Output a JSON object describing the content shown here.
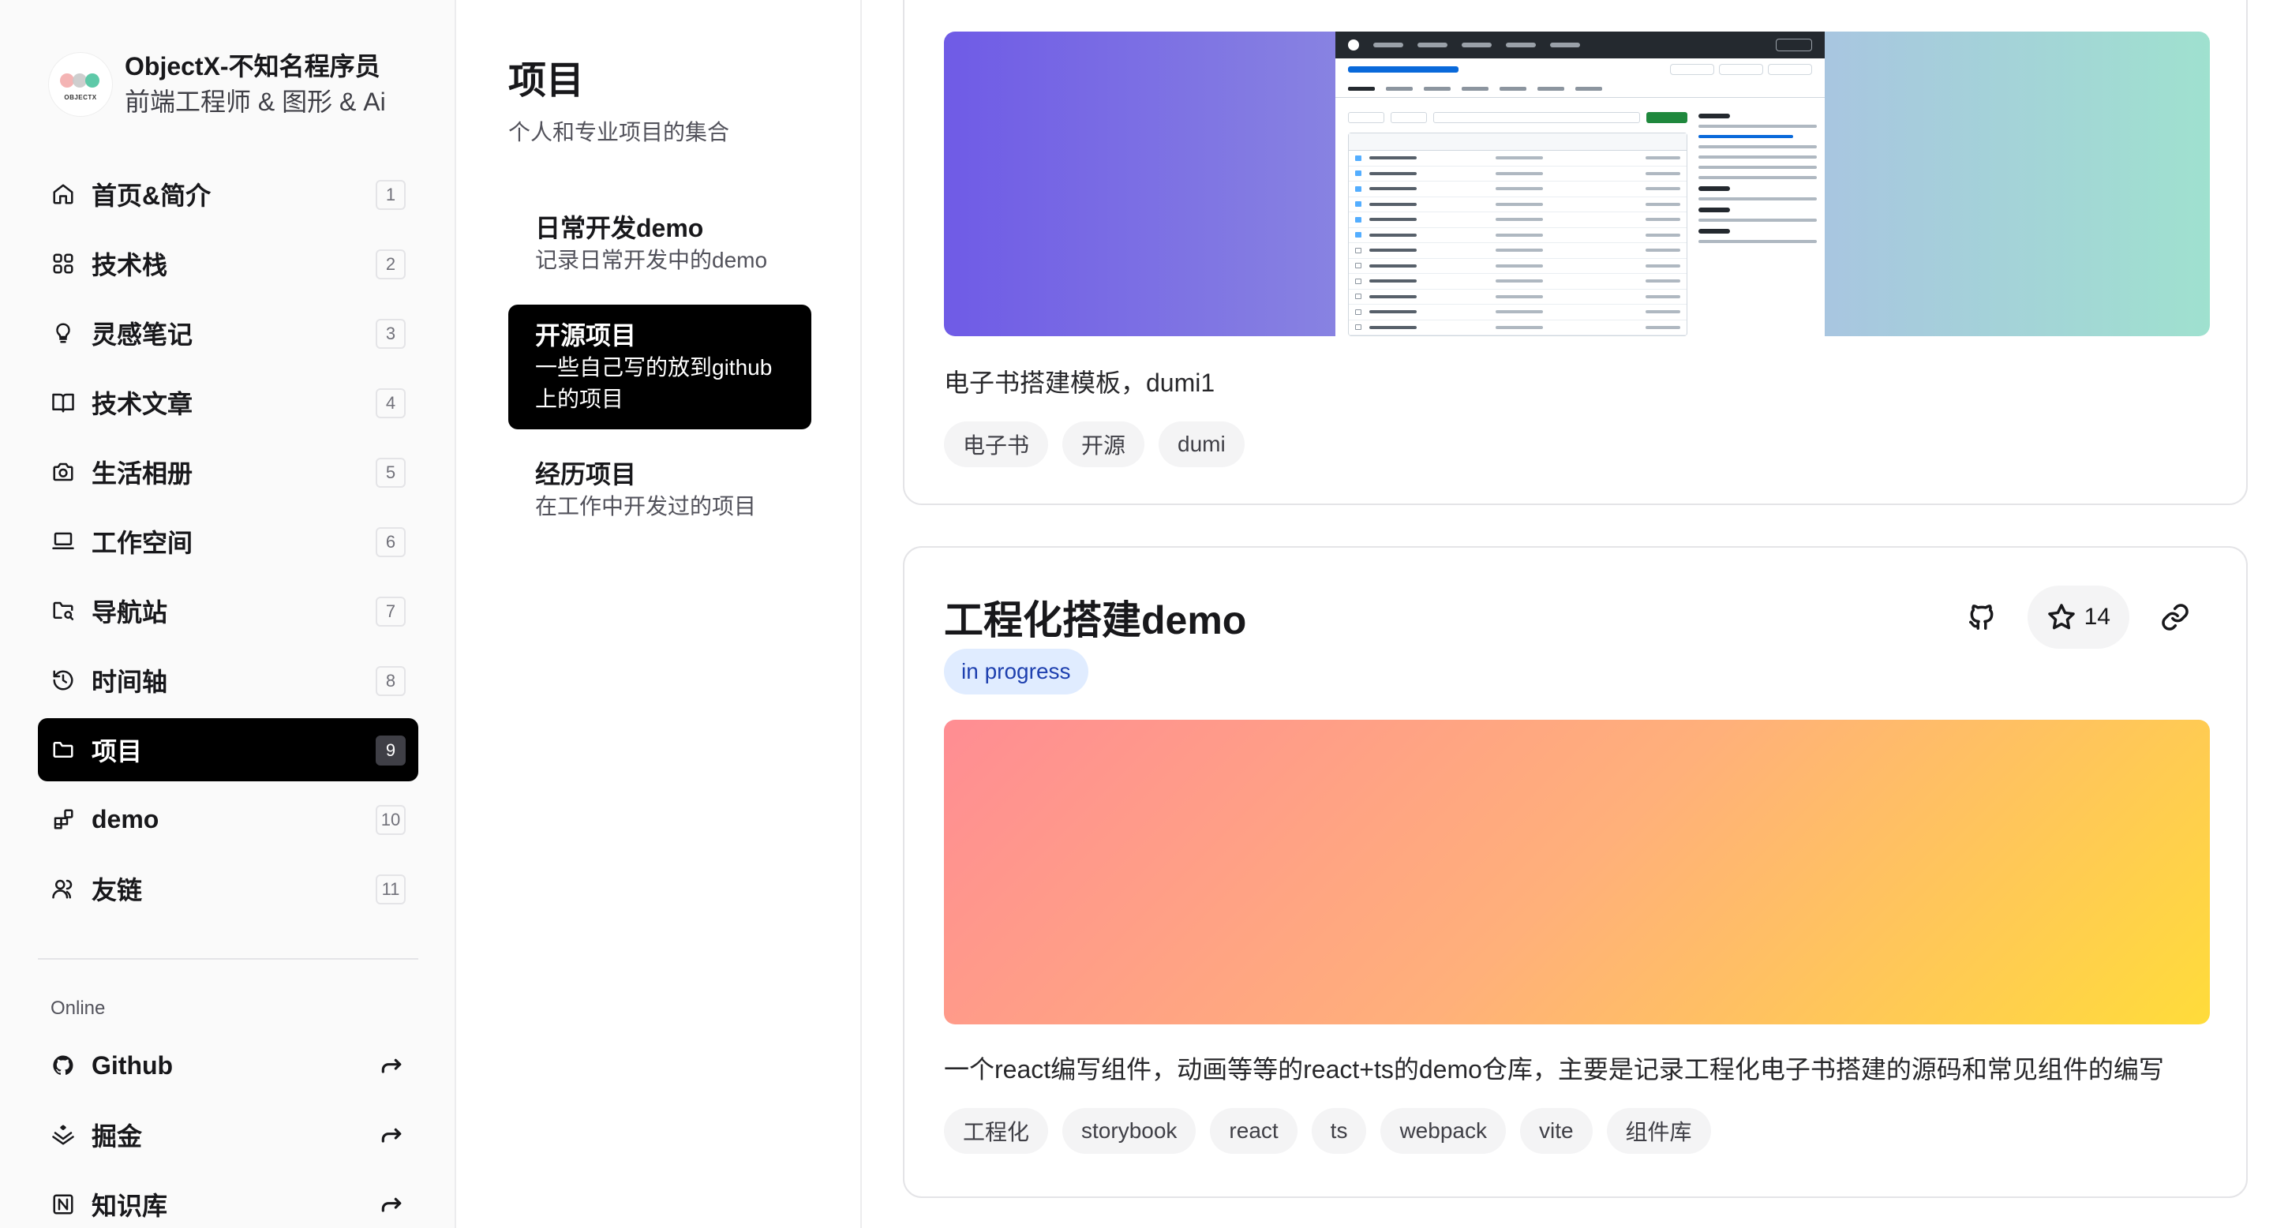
{
  "profile": {
    "name": "ObjectX-不知名程序员",
    "subtitle": "前端工程师 & 图形 & Ai",
    "avatar_text": "OBJECTX"
  },
  "nav": [
    {
      "label": "首页&简介",
      "badge": "1",
      "icon": "home-icon"
    },
    {
      "label": "技术栈",
      "badge": "2",
      "icon": "stack-icon"
    },
    {
      "label": "灵感笔记",
      "badge": "3",
      "icon": "lightbulb-icon"
    },
    {
      "label": "技术文章",
      "badge": "4",
      "icon": "book-open-icon"
    },
    {
      "label": "生活相册",
      "badge": "5",
      "icon": "camera-icon"
    },
    {
      "label": "工作空间",
      "badge": "6",
      "icon": "laptop-icon"
    },
    {
      "label": "导航站",
      "badge": "7",
      "icon": "folder-search-icon"
    },
    {
      "label": "时间轴",
      "badge": "8",
      "icon": "history-icon"
    },
    {
      "label": "项目",
      "badge": "9",
      "icon": "folder-icon",
      "active": true
    },
    {
      "label": "demo",
      "badge": "10",
      "icon": "blocks-icon"
    },
    {
      "label": "友链",
      "badge": "11",
      "icon": "users-icon"
    }
  ],
  "online": {
    "heading": "Online",
    "items": [
      {
        "label": "Github",
        "icon": "github-icon"
      },
      {
        "label": "掘金",
        "icon": "juejin-icon"
      },
      {
        "label": "知识库",
        "icon": "notion-icon"
      }
    ]
  },
  "projects": {
    "title": "项目",
    "subtitle": "个人和专业项目的集合",
    "items": [
      {
        "title": "日常开发demo",
        "desc": "记录日常开发中的demo"
      },
      {
        "title": "开源项目",
        "desc": "一些自己写的放到github上的项目",
        "active": true
      },
      {
        "title": "经历项目",
        "desc": "在工作中开发过的项目"
      }
    ]
  },
  "cards": [
    {
      "description": "电子书搭建模板，dumi1",
      "tags": [
        "电子书",
        "开源",
        "dumi"
      ]
    },
    {
      "title": "工程化搭建demo",
      "status": "in progress",
      "stars": "14",
      "description": "一个react编写组件，动画等等的react+ts的demo仓库，主要是记录工程化电子书搭建的源码和常见组件的编写",
      "tags": [
        "工程化",
        "storybook",
        "react",
        "ts",
        "webpack",
        "vite",
        "组件库"
      ]
    }
  ],
  "colors": {
    "accent": "#000000",
    "status_bg": "#e0ecff",
    "status_text": "#1e40af"
  }
}
